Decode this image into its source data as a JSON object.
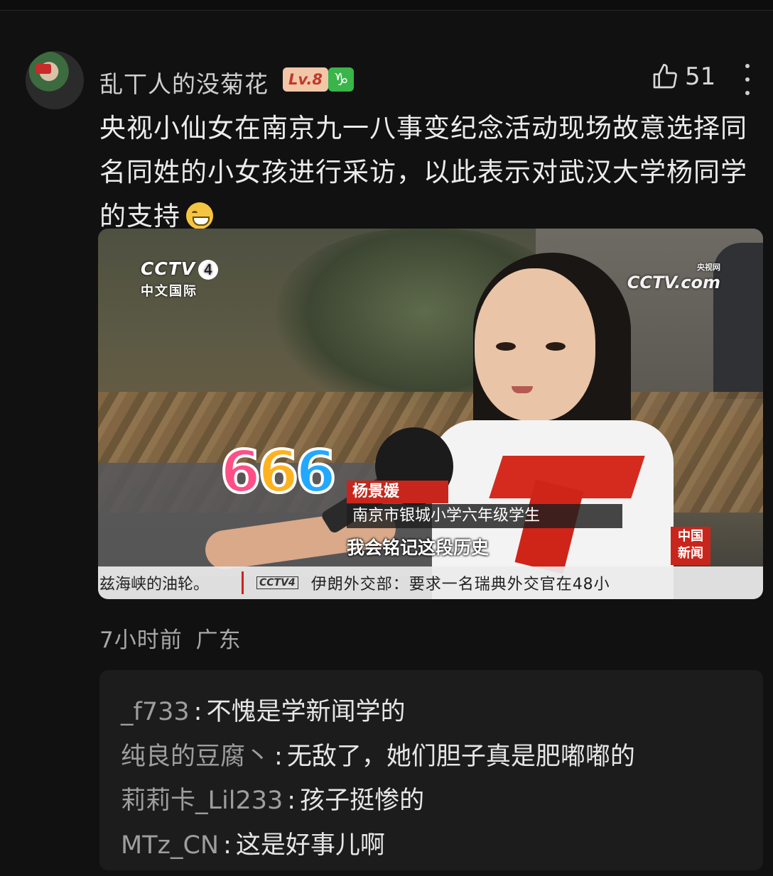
{
  "comment": {
    "username": "乱丅人的没菊花",
    "level_badge": "Lv.8",
    "sign_badge_icon": "capricorn-icon",
    "like_count": "51",
    "text": "央视小仙女在南京九一八事变纪念活动现场故意选择同名同姓的小女孩进行采访，以此表示对武汉大学杨同学的支持",
    "time": "7小时前",
    "location": "广东"
  },
  "video": {
    "channel_logo": "CCTV",
    "channel_number": "4",
    "channel_name": "中文国际",
    "watermark": "CCTV",
    "watermark_sub": "央视网",
    "watermark_domain": ".com",
    "sticker": "666",
    "name_tag": "杨景媛",
    "title_tag": "南京市银城小学六年级学生",
    "subtitle": "我会铭记这段历史",
    "corner_badge": "中国\n新闻",
    "ticker_left": "兹海峡的油轮。",
    "ticker_logo": "CCTV4",
    "ticker_right": "伊朗外交部：要求一名瑞典外交官在48小"
  },
  "replies": [
    {
      "author": "_f733",
      "text": "不愧是学新闻学的"
    },
    {
      "author": "纯良的豆腐丶",
      "text": "无敌了，她们胆子真是肥嘟嘟的"
    },
    {
      "author": "莉莉卡_Lil233",
      "text": "孩子挺惨的"
    },
    {
      "author": "MTz_CN",
      "text": "这是好事儿啊"
    }
  ],
  "colors": {
    "background": "#111111",
    "reply_box": "#1c1c1c",
    "level_badge_bg": "#f2c6a8",
    "sign_badge_bg": "#39b54a",
    "news_red": "#c8261c"
  }
}
